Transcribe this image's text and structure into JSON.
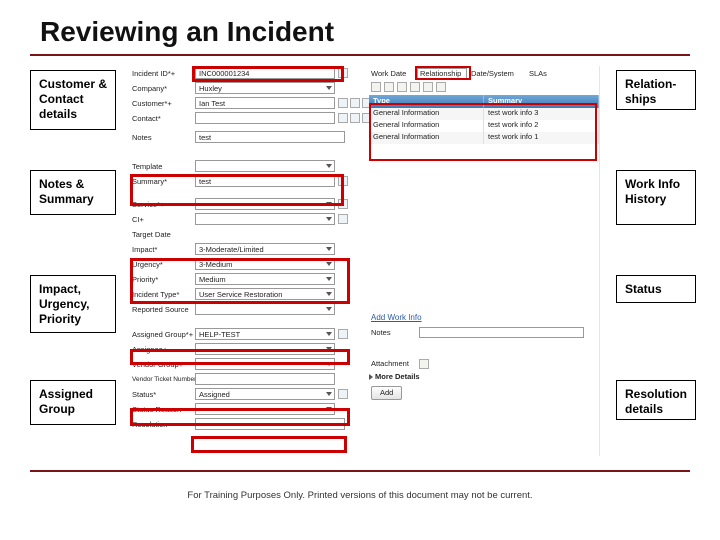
{
  "title": "Reviewing an Incident",
  "callouts": {
    "customer": "Customer & Contact details",
    "notes": "Notes & Summary",
    "impact": "Impact, Urgency, Priority",
    "assigned": "Assigned Group",
    "relationships": "Relation-ships",
    "workinfo": "Work Info History",
    "status": "Status",
    "resolution": "Resolution details"
  },
  "fields": {
    "incident_id_lbl": "Incident ID*+",
    "incident_id": "INC000001234",
    "company_lbl": "Company*",
    "company": "Huxley",
    "customer_lbl": "Customer*+",
    "customer": "Ian Test",
    "contact_lbl": "Contact*",
    "contact": "",
    "notes_lbl": "Notes",
    "notes": "test",
    "template_lbl": "Template",
    "template": "",
    "summary_lbl": "Summary*",
    "summary": "test",
    "service_lbl": "Service*+",
    "service": "",
    "ci_lbl": "CI+",
    "ci": "",
    "target_lbl": "Target Date",
    "target": "",
    "impact_lbl": "Impact*",
    "impact": "3-Moderate/Limited",
    "urgency_lbl": "Urgency*",
    "urgency": "3-Medium",
    "priority_lbl": "Priority*",
    "priority": "Medium",
    "inc_type_lbl": "Incident Type*",
    "inc_type": "User Service Restoration",
    "rep_src_lbl": "Reported Source",
    "rep_src": "",
    "assigned_grp_lbl": "Assigned Group*+",
    "assigned_grp": "HELP-TEST",
    "assignee_lbl": "Assignee+",
    "assignee": "",
    "vendor_grp_lbl": "Vendor Group+",
    "vendor_grp": "",
    "vendor_tkt_lbl": "Vendor Ticket Number",
    "vendor_tkt": "",
    "status_lbl": "Status*",
    "status": "Assigned",
    "status_reason_lbl": "Status Reason",
    "status_reason": "",
    "resolution_lbl": "Resolution",
    "resolution": ""
  },
  "right_panel": {
    "work_date_lbl": "Work Date",
    "relationship_btn": "Relationship",
    "date_system_lbl": "Date/System",
    "sla_lbl": "SLAs",
    "grid_header_type": "Type",
    "grid_header_summary": "Summary",
    "rows": [
      {
        "type": "General Information",
        "summary": "test work info 3"
      },
      {
        "type": "General Information",
        "summary": "test work info 2"
      },
      {
        "type": "General Information",
        "summary": "test work info 1"
      }
    ],
    "add_work_info": "Add Work Info",
    "notes_lbl": "Notes",
    "attachment_lbl": "Attachment",
    "more_details": "More Details",
    "add_btn": "Add"
  },
  "footnote": "For Training Purposes Only. Printed versions of this document may not be current."
}
